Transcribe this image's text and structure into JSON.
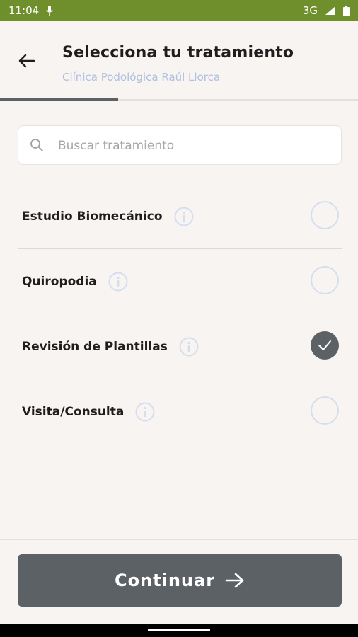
{
  "status_bar": {
    "time": "11:04",
    "network": "3G",
    "icons": [
      "mic-icon",
      "signal-icon",
      "battery-icon"
    ]
  },
  "header": {
    "title": "Selecciona tu tratamiento",
    "subtitle": "Clínica Podológica Raúl Llorca",
    "back_icon": "arrow-left-icon",
    "progress": 0.33
  },
  "search": {
    "placeholder": "Buscar tratamiento",
    "value": "",
    "icon": "search-icon"
  },
  "treatments": [
    {
      "name": "Estudio Biomecánico",
      "selected": false
    },
    {
      "name": "Quiropodia",
      "selected": false
    },
    {
      "name": "Revisión de Plantillas",
      "selected": true
    },
    {
      "name": "Visita/Consulta",
      "selected": false
    }
  ],
  "footer": {
    "continue_label": "Continuar",
    "continue_icon": "arrow-right-icon"
  },
  "colors": {
    "status_bar": "#6f8f2c",
    "background": "#f7f4f2",
    "primary": "#5c6166",
    "accent_light": "#aebfe0",
    "radio_border": "#d5deee"
  }
}
